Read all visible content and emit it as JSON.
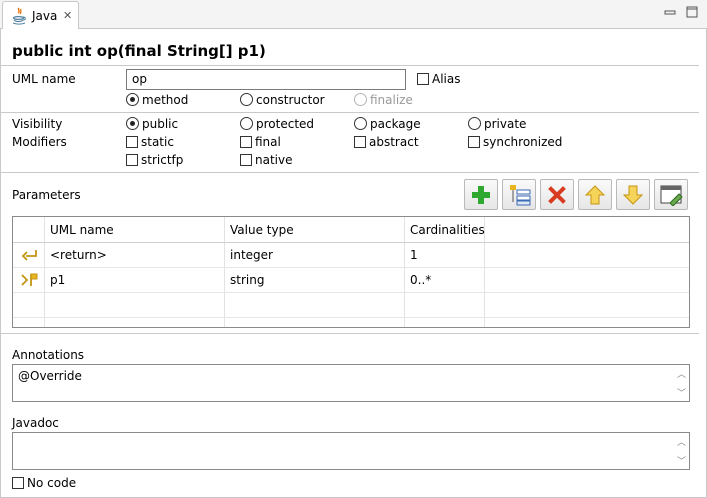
{
  "tab": {
    "label": "Java",
    "close_glyph": "✕"
  },
  "operation_title": "public int op(final String[] p1)",
  "uml_name": {
    "label": "UML name",
    "value": "op"
  },
  "alias": {
    "label": "Alias",
    "checked": false
  },
  "kind": {
    "method": {
      "label": "method",
      "selected": true
    },
    "constructor": {
      "label": "constructor",
      "selected": false
    },
    "finalize": {
      "label": "finalize",
      "selected": false,
      "disabled": true
    }
  },
  "visibility": {
    "label": "Visibility",
    "public": {
      "label": "public",
      "selected": true
    },
    "protected": {
      "label": "protected",
      "selected": false
    },
    "package": {
      "label": "package",
      "selected": false
    },
    "private": {
      "label": "private",
      "selected": false
    }
  },
  "modifiers": {
    "label": "Modifiers",
    "static": "static",
    "final": "final",
    "abstract": "abstract",
    "synchronized": "synchronized",
    "strictfp": "strictfp",
    "native": "native"
  },
  "parameters": {
    "label": "Parameters",
    "toolbar": [
      "add-icon",
      "add-from-type-icon",
      "delete-icon",
      "move-up-icon",
      "move-down-icon",
      "edit-icon"
    ],
    "columns": [
      "UML name",
      "Value type",
      "Cardinalities"
    ],
    "rows": [
      {
        "icon": "return-icon",
        "name": "<return>",
        "type": "integer",
        "card": "1"
      },
      {
        "icon": "parameter-icon",
        "name": "p1",
        "type": "string",
        "card": "0..*"
      }
    ]
  },
  "annotations": {
    "label": "Annotations",
    "value": "@Override"
  },
  "javadoc": {
    "label": "Javadoc",
    "value": ""
  },
  "no_code": {
    "label": "No code",
    "checked": false
  },
  "colors": {
    "add": "#2fa82f",
    "delete": "#d83b1f",
    "arrows": "#e8b521"
  }
}
